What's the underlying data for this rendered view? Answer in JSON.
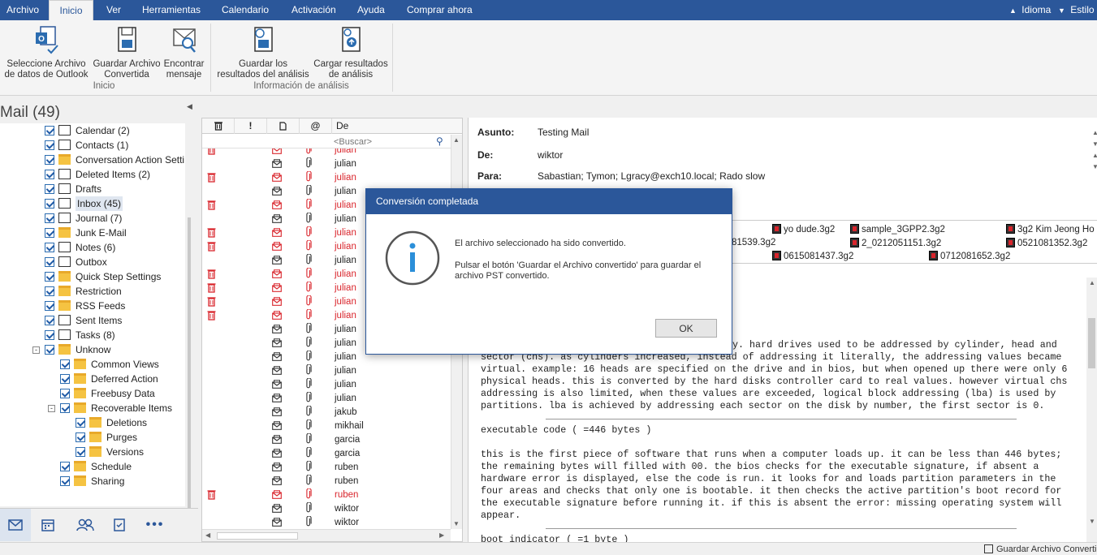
{
  "menu": {
    "items": [
      "Archivo",
      "Inicio",
      "Ver",
      "Herramientas",
      "Calendario",
      "Activación",
      "Ayuda",
      "Comprar ahora"
    ],
    "active": "Inicio",
    "right": [
      "Idioma",
      "Estilo"
    ]
  },
  "ribbon": {
    "buttons": [
      {
        "line1": "Seleccione Archivo",
        "line2": "de datos de Outlook",
        "icon": "select-outlook-file-icon"
      },
      {
        "line1": "Guardar Archivo",
        "line2": "Convertida",
        "icon": "save-file-icon"
      },
      {
        "line1": "Encontrar",
        "line2": "mensaje",
        "icon": "find-message-icon"
      },
      {
        "line1": "Guardar los",
        "line2": "resultados del análisis",
        "icon": "save-scan-icon"
      },
      {
        "line1": "Cargar resultados",
        "line2": "de análisis",
        "icon": "load-scan-icon"
      }
    ],
    "groups": [
      "Inicio",
      "Información de análisis"
    ]
  },
  "leftpane": {
    "title": "Mail (49)",
    "folders": [
      {
        "name": "Calendar (2)",
        "icon": "calendar-icon",
        "level": 1
      },
      {
        "name": "Contacts (1)",
        "icon": "contacts-icon",
        "level": 1
      },
      {
        "name": "Conversation Action Setti",
        "icon": "folder-icon",
        "level": 1
      },
      {
        "name": "Deleted Items (2)",
        "icon": "trash-icon",
        "level": 1
      },
      {
        "name": "Drafts",
        "icon": "drafts-icon",
        "level": 1
      },
      {
        "name": "Inbox (45)",
        "icon": "inbox-icon",
        "level": 1,
        "selected": true
      },
      {
        "name": "Journal (7)",
        "icon": "journal-icon",
        "level": 1
      },
      {
        "name": "Junk E-Mail",
        "icon": "folder-icon",
        "level": 1
      },
      {
        "name": "Notes (6)",
        "icon": "notes-icon",
        "level": 1
      },
      {
        "name": "Outbox",
        "icon": "outbox-icon",
        "level": 1
      },
      {
        "name": "Quick Step Settings",
        "icon": "folder-icon",
        "level": 1
      },
      {
        "name": "Restriction",
        "icon": "folder-icon",
        "level": 1
      },
      {
        "name": "RSS Feeds",
        "icon": "folder-icon",
        "level": 1
      },
      {
        "name": "Sent Items",
        "icon": "sent-icon",
        "level": 1
      },
      {
        "name": "Tasks (8)",
        "icon": "tasks-icon",
        "level": 1
      },
      {
        "name": "Unknow",
        "icon": "folder-icon",
        "level": 1,
        "expander": "-"
      },
      {
        "name": "Common Views",
        "icon": "folder-icon",
        "level": 2
      },
      {
        "name": "Deferred Action",
        "icon": "folder-icon",
        "level": 2
      },
      {
        "name": "Freebusy Data",
        "icon": "folder-icon",
        "level": 2
      },
      {
        "name": "Recoverable Items",
        "icon": "folder-icon",
        "level": 2,
        "expander": "-"
      },
      {
        "name": "Deletions",
        "icon": "folder-icon",
        "level": 3
      },
      {
        "name": "Purges",
        "icon": "folder-icon",
        "level": 3
      },
      {
        "name": "Versions",
        "icon": "folder-icon",
        "level": 3
      },
      {
        "name": "Schedule",
        "icon": "folder-icon",
        "level": 2
      },
      {
        "name": "Sharing",
        "icon": "folder-icon",
        "level": 2
      }
    ],
    "nav": [
      "mail-icon",
      "calendar-icon",
      "people-icon",
      "tasks-icon",
      "more-icon"
    ]
  },
  "msglist": {
    "header_from": "De",
    "search_placeholder": "<Buscar>",
    "rows": [
      {
        "from": "julian",
        "deleted": true
      },
      {
        "from": "julian",
        "deleted": false
      },
      {
        "from": "julian",
        "deleted": true
      },
      {
        "from": "julian",
        "deleted": false
      },
      {
        "from": "julian",
        "deleted": true
      },
      {
        "from": "julian",
        "deleted": false
      },
      {
        "from": "julian",
        "deleted": true
      },
      {
        "from": "julian",
        "deleted": true
      },
      {
        "from": "julian",
        "deleted": false
      },
      {
        "from": "julian",
        "deleted": true
      },
      {
        "from": "julian",
        "deleted": true
      },
      {
        "from": "julian",
        "deleted": true
      },
      {
        "from": "julian",
        "deleted": true
      },
      {
        "from": "julian",
        "deleted": false
      },
      {
        "from": "julian",
        "deleted": false
      },
      {
        "from": "julian",
        "deleted": false
      },
      {
        "from": "julian",
        "deleted": false
      },
      {
        "from": "julian",
        "deleted": false
      },
      {
        "from": "julian",
        "deleted": false
      },
      {
        "from": "jakub",
        "deleted": false
      },
      {
        "from": "mikhail",
        "deleted": false
      },
      {
        "from": "garcia",
        "deleted": false
      },
      {
        "from": "garcia",
        "deleted": false
      },
      {
        "from": "ruben",
        "deleted": false
      },
      {
        "from": "ruben",
        "deleted": false
      },
      {
        "from": "ruben",
        "deleted": true
      },
      {
        "from": "wiktor",
        "deleted": false
      },
      {
        "from": "wiktor",
        "deleted": false
      }
    ]
  },
  "reading": {
    "subject_label": "Asunto:",
    "subject": "Testing Mail",
    "from_label": "De:",
    "from": "wiktor",
    "to_label": "Para:",
    "to": "Sabastian; Tymon; Lgracy@exch10.local; Rado slow",
    "attachments": [
      {
        "name": "yo dude.3g2"
      },
      {
        "name": "sample_3GPP2.3g2"
      },
      {
        "name": "3g2 Kim Jeong Ho"
      },
      {
        "name": "81539.3g2"
      },
      {
        "name": "2_0212051151.3g2"
      },
      {
        "name": "0521081352.3g2"
      },
      {
        "name": "0615081437.3g2"
      },
      {
        "name": "0712081652.3g2"
      }
    ],
    "body_lines": [
      "y. hard drives used to be addressed by cylinder, head and",
      "sector (chs). as cylinders increased, instead of addressing it literally, the addressing values became",
      "virtual. example: 16 heads are specified on the drive and in bios, but when opened up there were only 6",
      "physical heads. this is converted by the hard disks controller card to real values. however virtual chs",
      "addressing is also limited, when these values are exceeded, logical block addressing (lba) is used by",
      "partitions. lba is achieved by addressing each sector on the disk by number, the first sector is 0.",
      "",
      "executable code ( =446 bytes )",
      "",
      "this is the first piece of software that runs when a computer loads up. it can be less than 446 bytes;",
      "the remaining bytes will filled with 00. the bios checks for the executable signature, if absent a",
      "hardware error is displayed, else the code is run. it looks for and loads partition parameters in the",
      "four areas and checks that only one is bootable. it then checks the active partition's boot record for",
      "the executable signature before running it. if this is absent the error: missing operating system will",
      "appear.",
      "",
      "boot indicator ( =1 byte )"
    ]
  },
  "status": {
    "text": "Guardar Archivo Convertida"
  },
  "dialog": {
    "title": "Conversión completada",
    "message1": "El archivo seleccionado ha sido convertido.",
    "message2": "Pulsar el botón  'Guardar el Archivo convertido' para guardar el archivo PST convertido.",
    "ok_label": "OK"
  },
  "colors": {
    "accent": "#2b579a",
    "deleted_red": "#d9252c"
  }
}
